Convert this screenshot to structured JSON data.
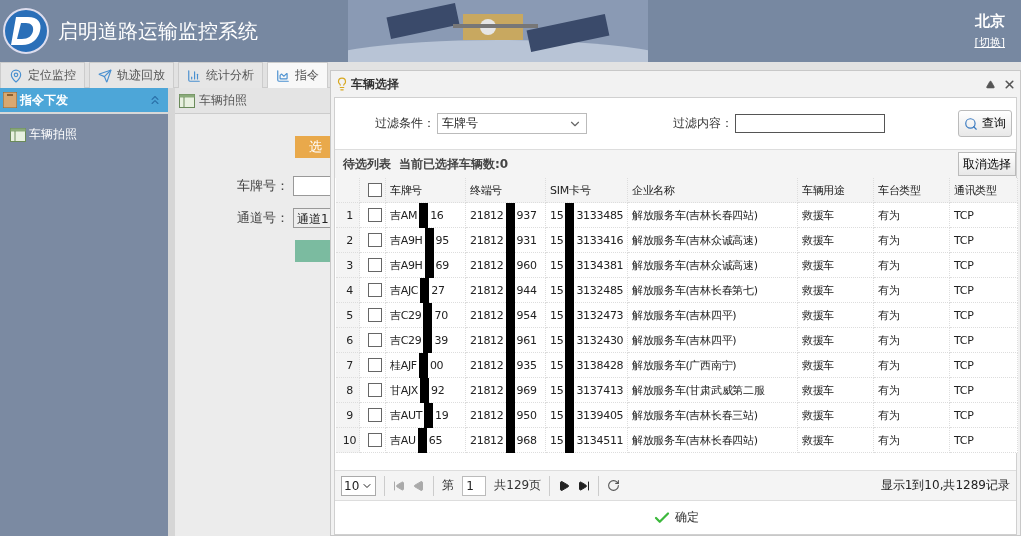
{
  "header": {
    "title": "启明道路运输监控系统",
    "city": "北京",
    "switch_link": "[切换]"
  },
  "tabs": [
    {
      "label": "定位监控",
      "selected": false
    },
    {
      "label": "轨迹回放",
      "selected": false
    },
    {
      "label": "统计分析",
      "selected": false
    },
    {
      "label": "指令",
      "selected": true
    }
  ],
  "sidebar": {
    "title": "指令下发",
    "items": [
      {
        "label": "车辆拍照",
        "selected": false
      }
    ]
  },
  "panel": {
    "title": "车辆拍照",
    "select_button": "选",
    "fields": [
      {
        "label": "车牌号："
      },
      {
        "label": "通道号：",
        "value": "通道1"
      }
    ]
  },
  "dialog": {
    "title": "车辆选择",
    "filter": {
      "condition_label": "过滤条件：",
      "condition_value": "车牌号",
      "content_label": "过滤内容：",
      "query_button": "查询"
    },
    "list_title": "待选列表",
    "selected_count": "当前已选择车辆数:0",
    "clear_button": "取消选择",
    "table": {
      "select_all": false,
      "columns": [
        "车牌号",
        "终端号",
        "SIM卡号",
        "企业名称",
        "车辆用途",
        "车台类型",
        "通讯类型"
      ],
      "rows": [
        {
          "index": "1",
          "checked": false,
          "plate": [
            "吉AM",
            "16"
          ],
          "terminal": [
            "21812",
            "937"
          ],
          "sim": [
            "15",
            "3133485"
          ],
          "company": "解放服务车(吉林长春四站)",
          "use": "救援车",
          "type": "有为",
          "comm": "TCP"
        },
        {
          "index": "2",
          "checked": false,
          "plate": [
            "吉A9H",
            "95"
          ],
          "terminal": [
            "21812",
            "931"
          ],
          "sim": [
            "15",
            "3133416"
          ],
          "company": "解放服务车(吉林众诚高速)",
          "use": "救援车",
          "type": "有为",
          "comm": "TCP"
        },
        {
          "index": "3",
          "checked": false,
          "plate": [
            "吉A9H",
            "69"
          ],
          "terminal": [
            "21812",
            "960"
          ],
          "sim": [
            "15",
            "3134381"
          ],
          "company": "解放服务车(吉林众诚高速)",
          "use": "救援车",
          "type": "有为",
          "comm": "TCP"
        },
        {
          "index": "4",
          "checked": false,
          "plate": [
            "吉AJC",
            "27"
          ],
          "terminal": [
            "21812",
            "944"
          ],
          "sim": [
            "15",
            "3132485"
          ],
          "company": "解放服务车(吉林长春第七)",
          "use": "救援车",
          "type": "有为",
          "comm": "TCP"
        },
        {
          "index": "5",
          "checked": false,
          "plate": [
            "吉C29",
            "70"
          ],
          "terminal": [
            "21812",
            "954"
          ],
          "sim": [
            "15",
            "3132473"
          ],
          "company": "解放服务车(吉林四平)",
          "use": "救援车",
          "type": "有为",
          "comm": "TCP"
        },
        {
          "index": "6",
          "checked": false,
          "plate": [
            "吉C29",
            "39"
          ],
          "terminal": [
            "21812",
            "961"
          ],
          "sim": [
            "15",
            "3132430"
          ],
          "company": "解放服务车(吉林四平)",
          "use": "救援车",
          "type": "有为",
          "comm": "TCP"
        },
        {
          "index": "7",
          "checked": false,
          "plate": [
            "桂AJF",
            "00"
          ],
          "terminal": [
            "21812",
            "935"
          ],
          "sim": [
            "15",
            "3138428"
          ],
          "company": "解放服务车(广西南宁)",
          "use": "救援车",
          "type": "有为",
          "comm": "TCP"
        },
        {
          "index": "8",
          "checked": false,
          "plate": [
            "甘AJX",
            "92"
          ],
          "terminal": [
            "21812",
            "969"
          ],
          "sim": [
            "15",
            "3137413"
          ],
          "company": "解放服务车(甘肃武威第二服",
          "use": "救援车",
          "type": "有为",
          "comm": "TCP"
        },
        {
          "index": "9",
          "checked": false,
          "plate": [
            "吉AUT",
            "19"
          ],
          "terminal": [
            "21812",
            "950"
          ],
          "sim": [
            "15",
            "3139405"
          ],
          "company": "解放服务车(吉林长春三站)",
          "use": "救援车",
          "type": "有为",
          "comm": "TCP"
        },
        {
          "index": "10",
          "checked": false,
          "plate": [
            "吉AU",
            "65"
          ],
          "terminal": [
            "21812",
            "968"
          ],
          "sim": [
            "15",
            "3134511"
          ],
          "company": "解放服务车(吉林长春四站)",
          "use": "救援车",
          "type": "有为",
          "comm": "TCP"
        }
      ]
    },
    "pager": {
      "page_size": "10",
      "page_prefix": "第",
      "page": "1",
      "page_total": "共129页",
      "summary": "显示1到10,共1289记录"
    },
    "ok_button": "确定"
  }
}
